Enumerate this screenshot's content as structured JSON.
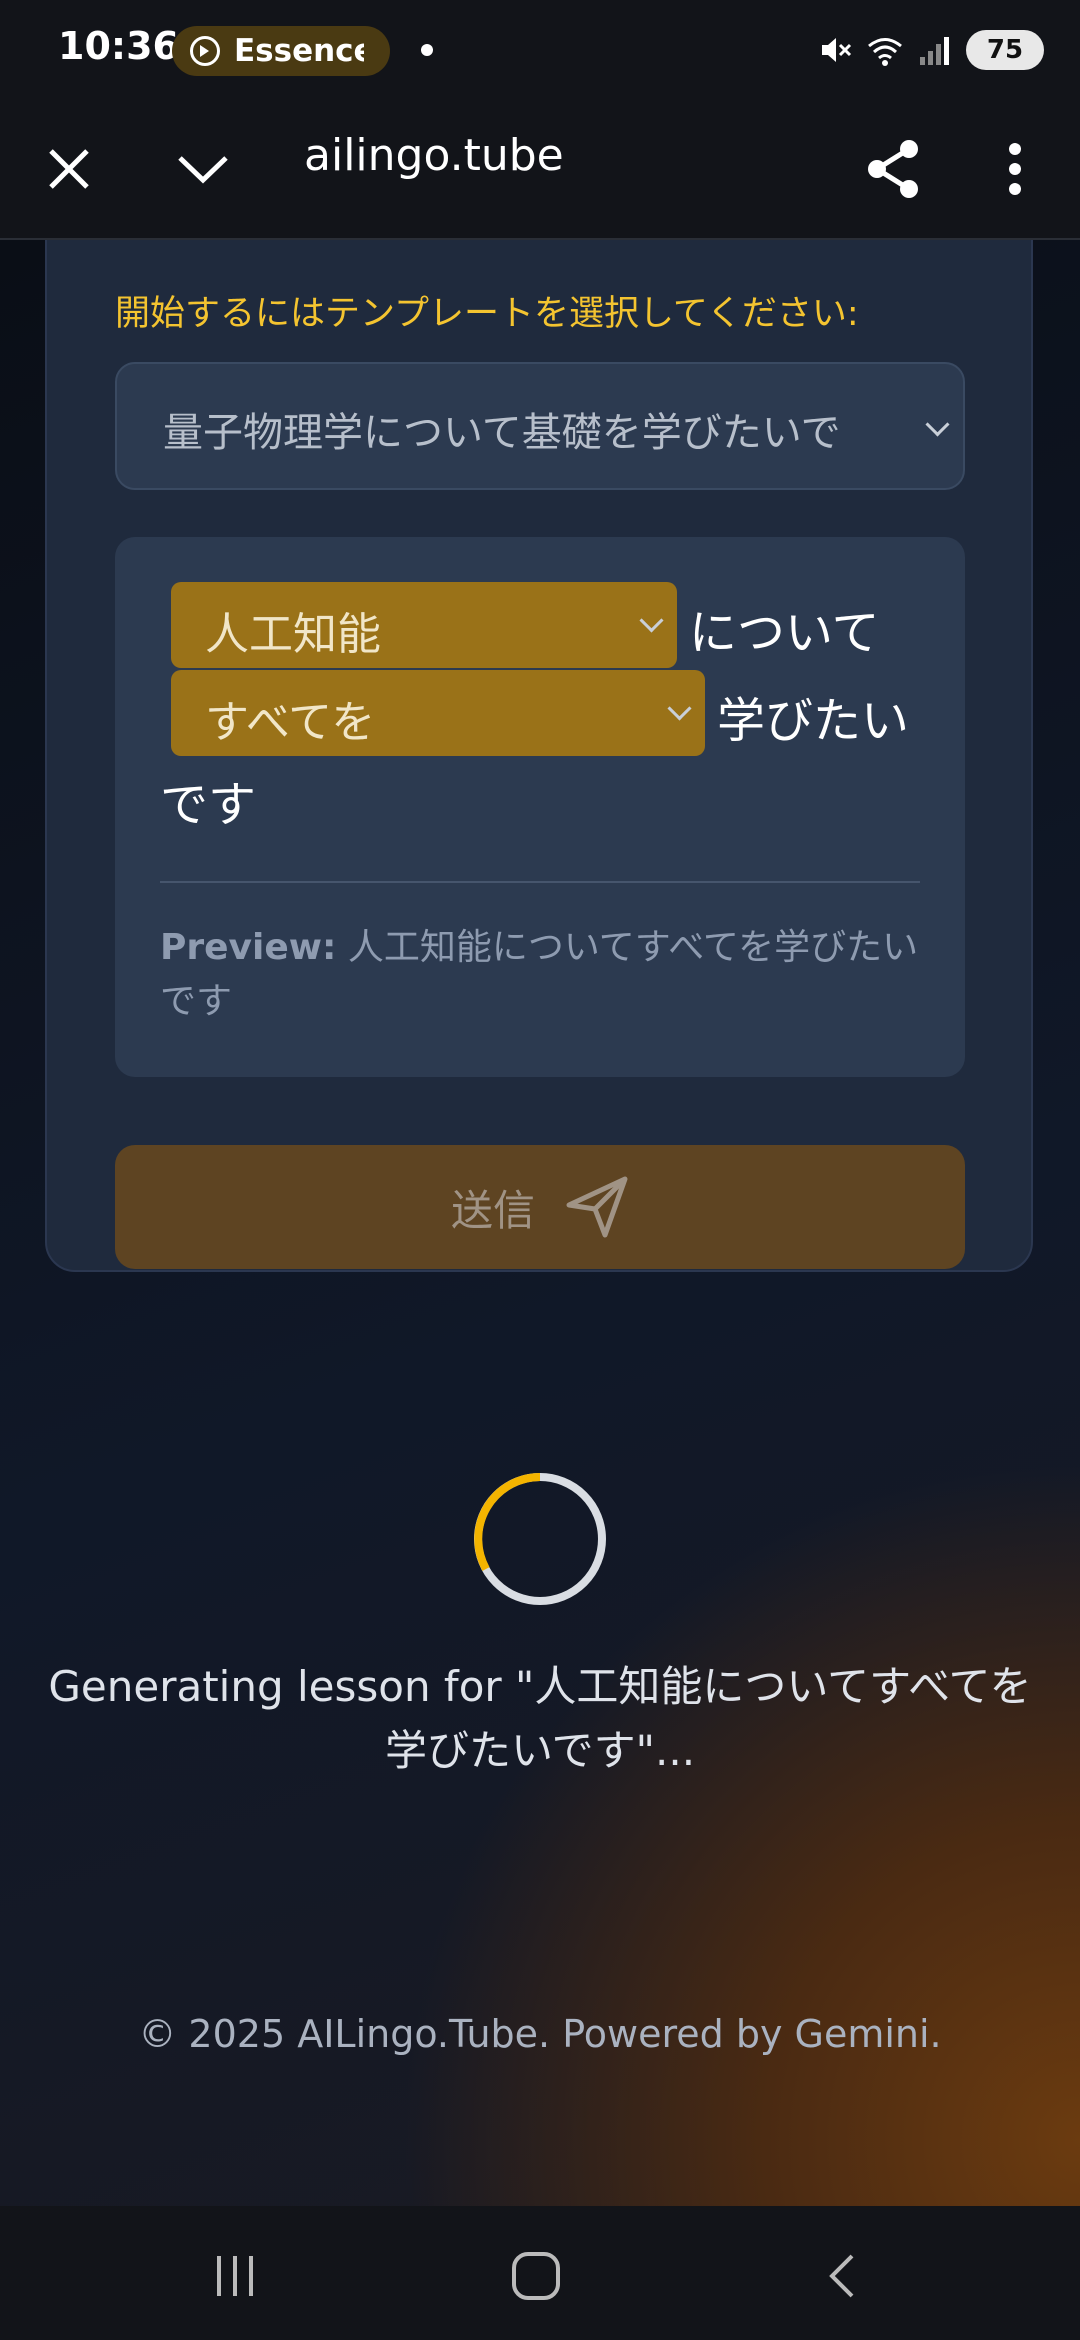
{
  "status_bar": {
    "time": "10:36",
    "media_pill": "Essence (",
    "battery": "75"
  },
  "browser": {
    "url": "ailingo.tube",
    "icons": [
      "close-icon",
      "chevron-down-icon",
      "share-icon",
      "more-vert-icon"
    ]
  },
  "form": {
    "prompt_label": "開始するにはテンプレートを選択してください:",
    "template_selected": "量子物理学について基礎を学びたいで",
    "topic_dropdown": "人工知能",
    "topic_suffix": "について",
    "scope_dropdown": "すべてを",
    "scope_suffix": "学びたい",
    "sentence_end": "です",
    "preview_label": "Preview:",
    "preview_text": "人工知能についてすべてを学びたいです",
    "submit_label": "送信"
  },
  "loading": {
    "message": "Generating lesson for \"人工知能についてすべてを学びたいです\"..."
  },
  "footer": {
    "text": "© 2025 AILingo.Tube. Powered by Gemini."
  },
  "colors": {
    "accent": "#f4c430",
    "dropdown_bg": "#9a7218",
    "card_bg": "#1f2a3d",
    "submit_bg": "#5e4422"
  }
}
